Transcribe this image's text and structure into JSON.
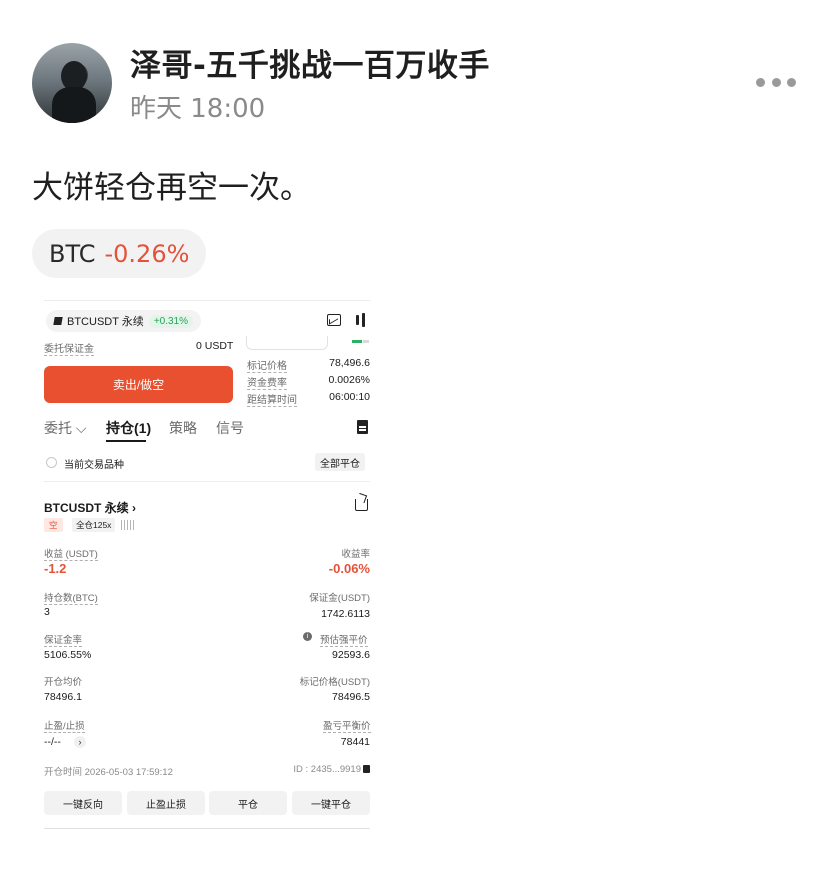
{
  "post": {
    "username": "泽哥-五千挑战一百万收手",
    "time": "昨天 18:00",
    "text": "大饼轻仓再空一次。"
  },
  "ticker": {
    "symbol": "BTC",
    "change": "-0.26%",
    "change_color": "#e4523a"
  },
  "trade": {
    "pair": "BTCUSDT 永续",
    "pair_change": "+0.31%",
    "entrusted_margin_label": "委托保证金",
    "entrusted_margin_value": "0 USDT",
    "stats": [
      {
        "label": "标记价格",
        "value": "78,496.6"
      },
      {
        "label": "资金费率",
        "value": "0.0026%"
      },
      {
        "label": "距结算时间",
        "value": "06:00:10"
      }
    ],
    "sell_label": "卖出/做空",
    "tabs": [
      "委托 ⌵",
      "持仓(1)",
      "策略",
      "信号"
    ],
    "current_pair_only": "当前交易品种",
    "close_all": "全部平仓",
    "position": {
      "title": "BTCUSDT 永续 ›",
      "side": "空",
      "margin_mode": "全仓125x",
      "pnl_label": "收益 (USDT)",
      "pnl_value": "-1.2",
      "roi_label": "收益率",
      "roi_value": "-0.06%",
      "size_label": "持仓数(BTC)",
      "size_value": "3",
      "margin_label": "保证金(USDT)",
      "margin_value": "1742.6113",
      "margin_ratio_label": "保证金率",
      "margin_ratio_value": "5106.55%",
      "liq_label": "预估强平价",
      "liq_value": "92593.6",
      "entry_label": "开仓均价",
      "entry_value": "78496.1",
      "mark_label": "标记价格(USDT)",
      "mark_value": "78496.5",
      "tpsl_label": "止盈/止损",
      "tpsl_value": "--/--",
      "breakeven_label": "盈亏平衡价",
      "breakeven_value": "78441",
      "open_time": "开仓时间 2026-05-03 17:59:12",
      "id": "ID : 2435...9919"
    },
    "actions": [
      "一键反向",
      "止盈止损",
      "平仓",
      "一键平仓"
    ]
  }
}
